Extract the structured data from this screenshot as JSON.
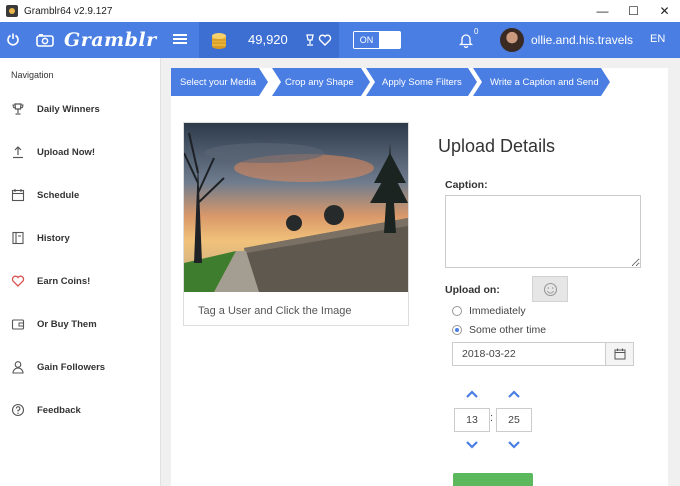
{
  "window": {
    "title": "Gramblr64 v2.9.127",
    "minimize_glyph": "—",
    "maximize_glyph": "☐",
    "close_glyph": "✕"
  },
  "header": {
    "logo": "Gramblr",
    "coins": "49,920",
    "toggle_label": "ON",
    "notification_count": "0",
    "username": "ollie.and.his.travels",
    "language": "EN"
  },
  "sidebar": {
    "title": "Navigation",
    "items": [
      {
        "label": "Daily Winners",
        "icon": "trophy-icon"
      },
      {
        "label": "Upload Now!",
        "icon": "upload-icon"
      },
      {
        "label": "Schedule",
        "icon": "calendar-icon"
      },
      {
        "label": "History",
        "icon": "book-icon"
      },
      {
        "label": "Earn Coins!",
        "icon": "heart-icon"
      },
      {
        "label": "Or Buy Them",
        "icon": "wallet-icon"
      },
      {
        "label": "Gain Followers",
        "icon": "user-icon"
      },
      {
        "label": "Feedback",
        "icon": "question-icon"
      }
    ]
  },
  "steps": [
    "Select your Media",
    "Crop any Shape",
    "Apply Some Filters",
    "Write a Caption and Send"
  ],
  "media": {
    "tag_hint": "Tag a User and Click the Image"
  },
  "upload": {
    "title": "Upload Details",
    "caption_label": "Caption:",
    "caption_value": "",
    "upload_on_label": "Upload on:",
    "option_immediately": "Immediately",
    "option_other": "Some other time",
    "date": "2018-03-22",
    "hour": "13",
    "minute": "25",
    "colon": ":"
  },
  "colors": {
    "brand_blue": "#4a7ee3",
    "send_green": "#5cb85c",
    "heart_red": "#d9534f"
  }
}
